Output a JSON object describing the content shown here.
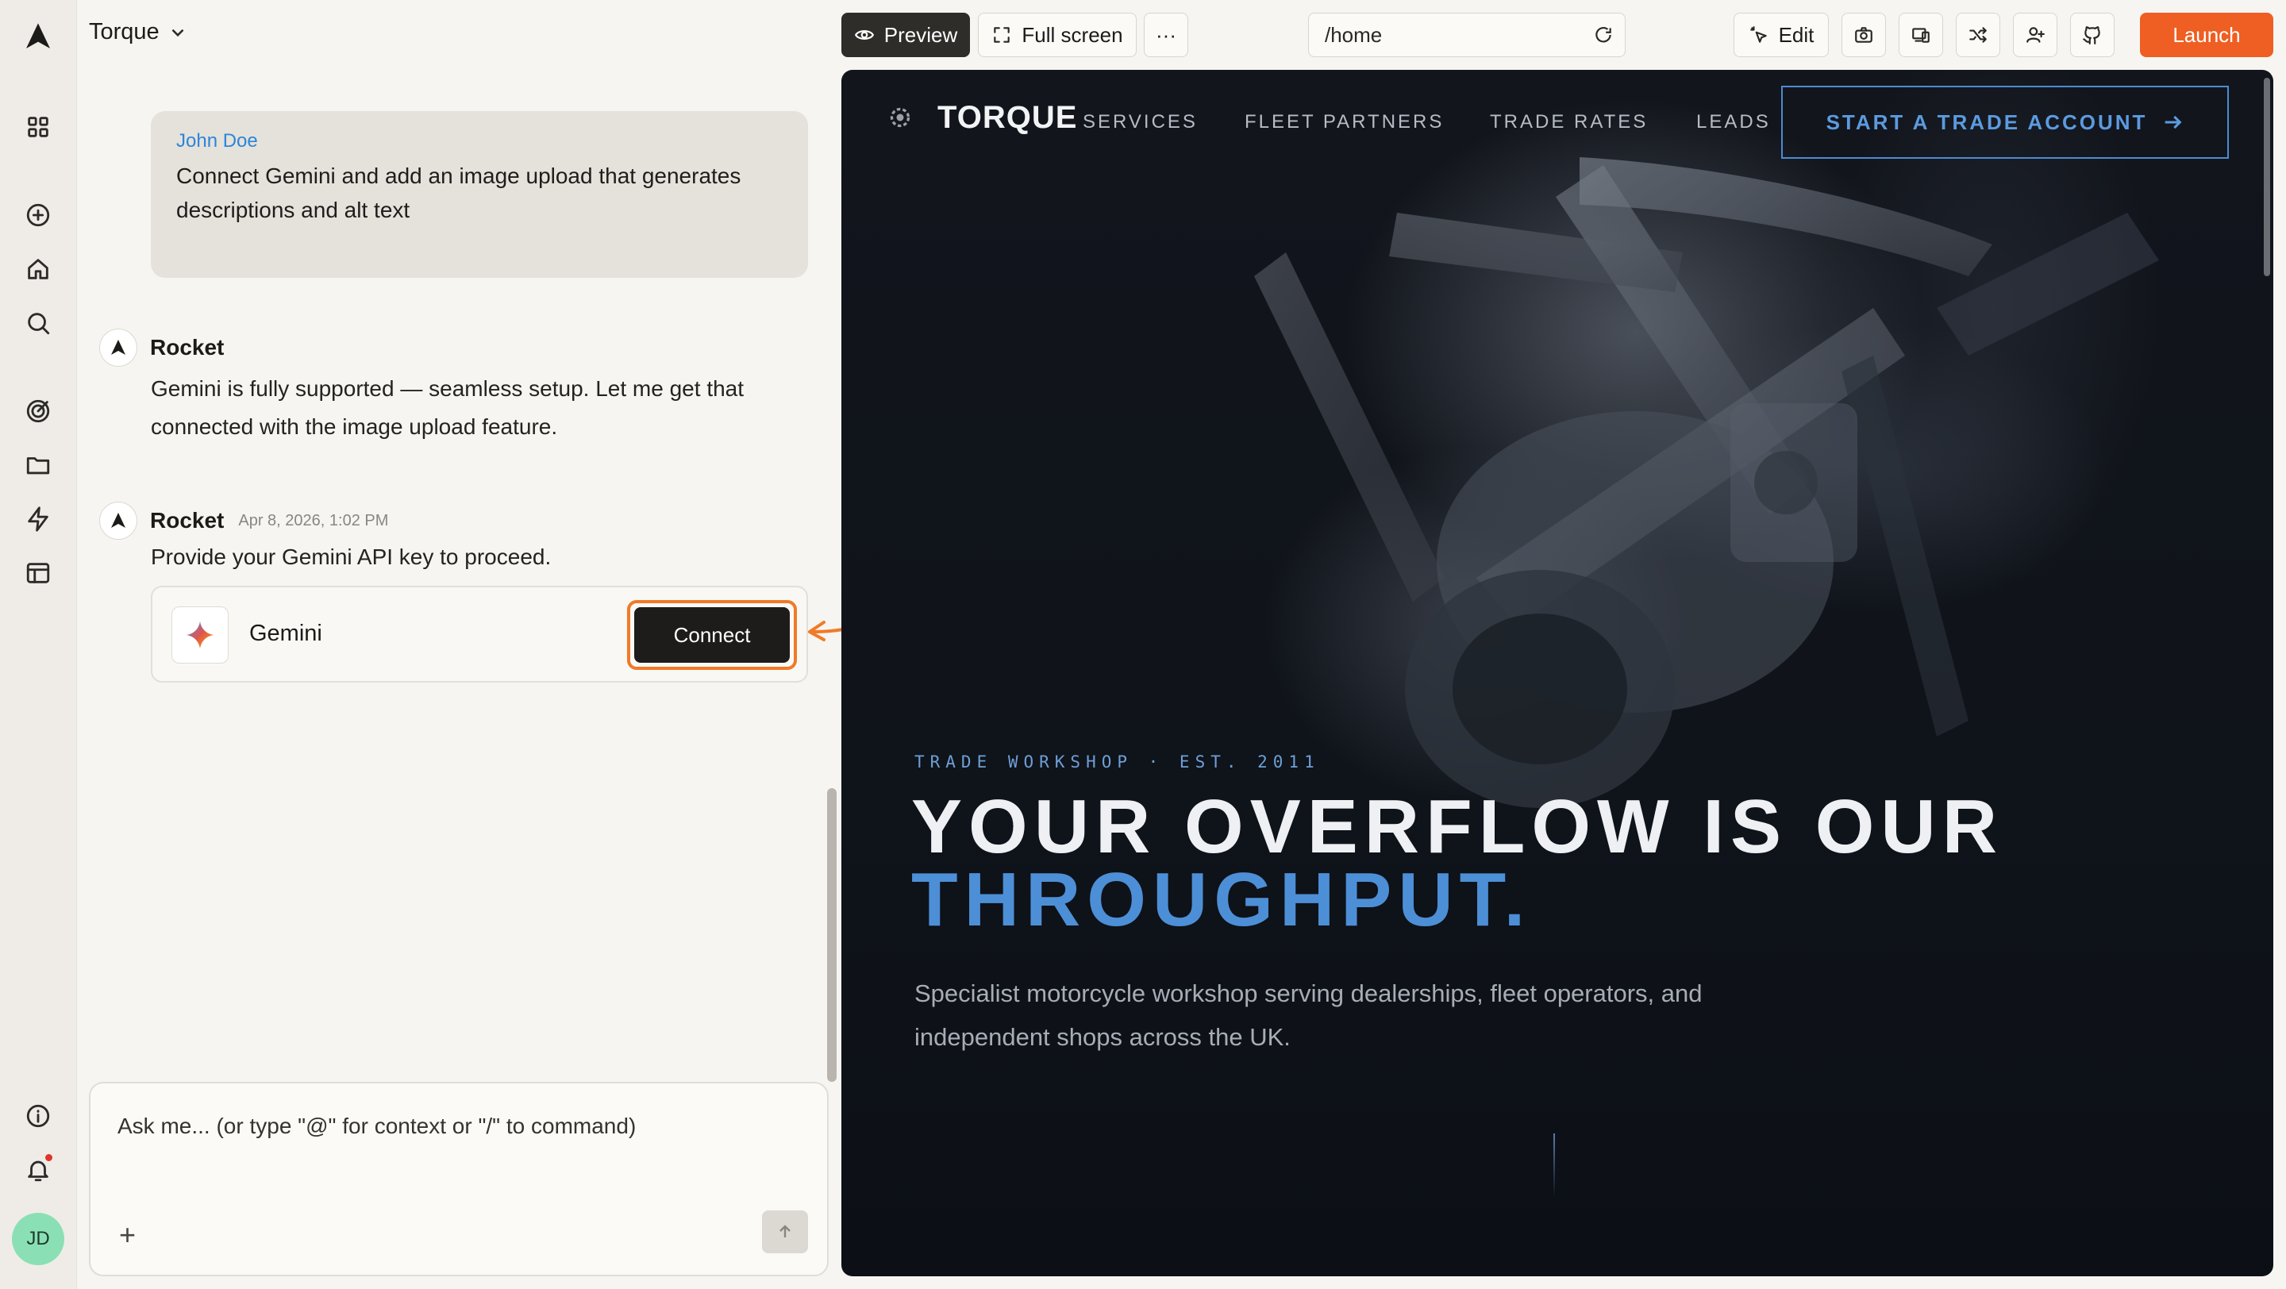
{
  "app": {
    "project_name": "Torque"
  },
  "chat": {
    "user_message": {
      "author": "John Doe",
      "text": "Connect Gemini and add an image upload that generates descriptions and alt text"
    },
    "bot_messages": [
      {
        "author": "Rocket",
        "time": "",
        "text": "Gemini is fully supported — seamless setup. Let me get that connected with the image upload feature."
      },
      {
        "author": "Rocket",
        "time": "Apr 8, 2026, 1:02 PM",
        "text": "Provide your Gemini API key to proceed."
      }
    ],
    "integration_card": {
      "name": "Gemini",
      "button_label": "Connect"
    },
    "composer": {
      "placeholder": "Ask me... (or type \"@\" for context or \"/\" to command)",
      "add_label": "+"
    }
  },
  "user": {
    "initials": "JD"
  },
  "toolbar": {
    "preview_label": "Preview",
    "fullscreen_label": "Full screen",
    "more_label": "···",
    "url": "/home",
    "edit_label": "Edit",
    "launch_label": "Launch"
  },
  "site": {
    "logo": "TORQUE",
    "nav": [
      "SERVICES",
      "FLEET PARTNERS",
      "TRADE RATES",
      "LEADS"
    ],
    "cta": "START A TRADE ACCOUNT",
    "eyebrow": "TRADE WORKSHOP · EST. 2011",
    "headline_line1": "YOUR OVERFLOW IS OUR",
    "headline_line2": "THROUGHPUT.",
    "subcopy": "Specialist motorcycle workshop serving dealerships, fleet operators, and independent shops across the UK."
  },
  "colors": {
    "accent": "#ef5e22",
    "highlight": "#f07a28",
    "site_blue": "#4d8fd6",
    "link_blue": "#2b86d9"
  }
}
